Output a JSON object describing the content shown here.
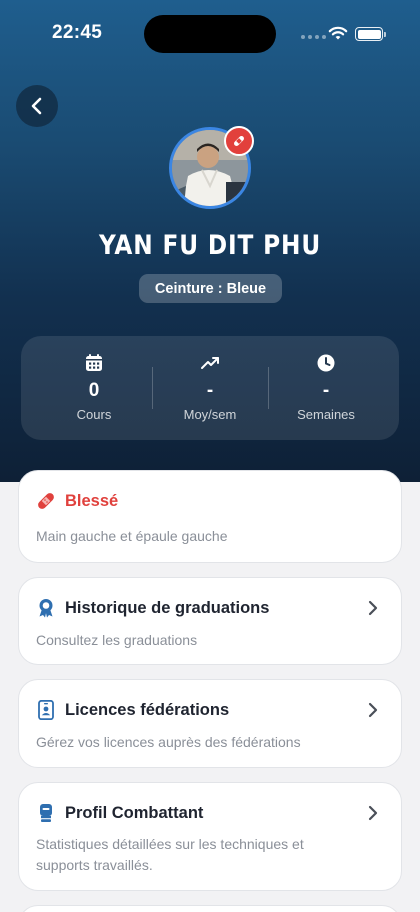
{
  "status_bar": {
    "time": "22:45",
    "icons": [
      "signal-dots",
      "wifi-icon",
      "battery-icon"
    ]
  },
  "header": {
    "back_icon": "chevron-left-icon"
  },
  "profile": {
    "name": "YAN FU DIT PHU",
    "belt": "Ceinture : Bleue",
    "avatar": "profile photo",
    "badge_icon": "bandage-icon"
  },
  "stats": [
    {
      "icon": "calendar-icon",
      "value": "0",
      "label": "Cours"
    },
    {
      "icon": "trending-up-icon",
      "value": "-",
      "label": "Moy/sem"
    },
    {
      "icon": "clock-icon",
      "value": "-",
      "label": "Semaines"
    }
  ],
  "cards": [
    {
      "icon": "bandage-icon",
      "title": "Blessé",
      "description": "Main gauche et épaule gauche",
      "has_chevron": false
    },
    {
      "icon": "award-icon",
      "title": "Historique de graduations",
      "description": "Consultez les graduations",
      "has_chevron": true
    },
    {
      "icon": "id-card-icon",
      "title": "Licences fédérations",
      "description": "Gérez vos licences auprès des fédérations",
      "has_chevron": true
    },
    {
      "icon": "fighter-icon",
      "title": "Profil Combattant",
      "description": "Statistiques détaillées sur les techniques et supports travaillés.",
      "has_chevron": true
    }
  ],
  "colors": {
    "header_top": "#1f5e8e",
    "header_bottom": "#0e2036",
    "accent_blue": "#2f6fb0",
    "injury_red": "#e0413d",
    "background": "#f2f2f4"
  }
}
